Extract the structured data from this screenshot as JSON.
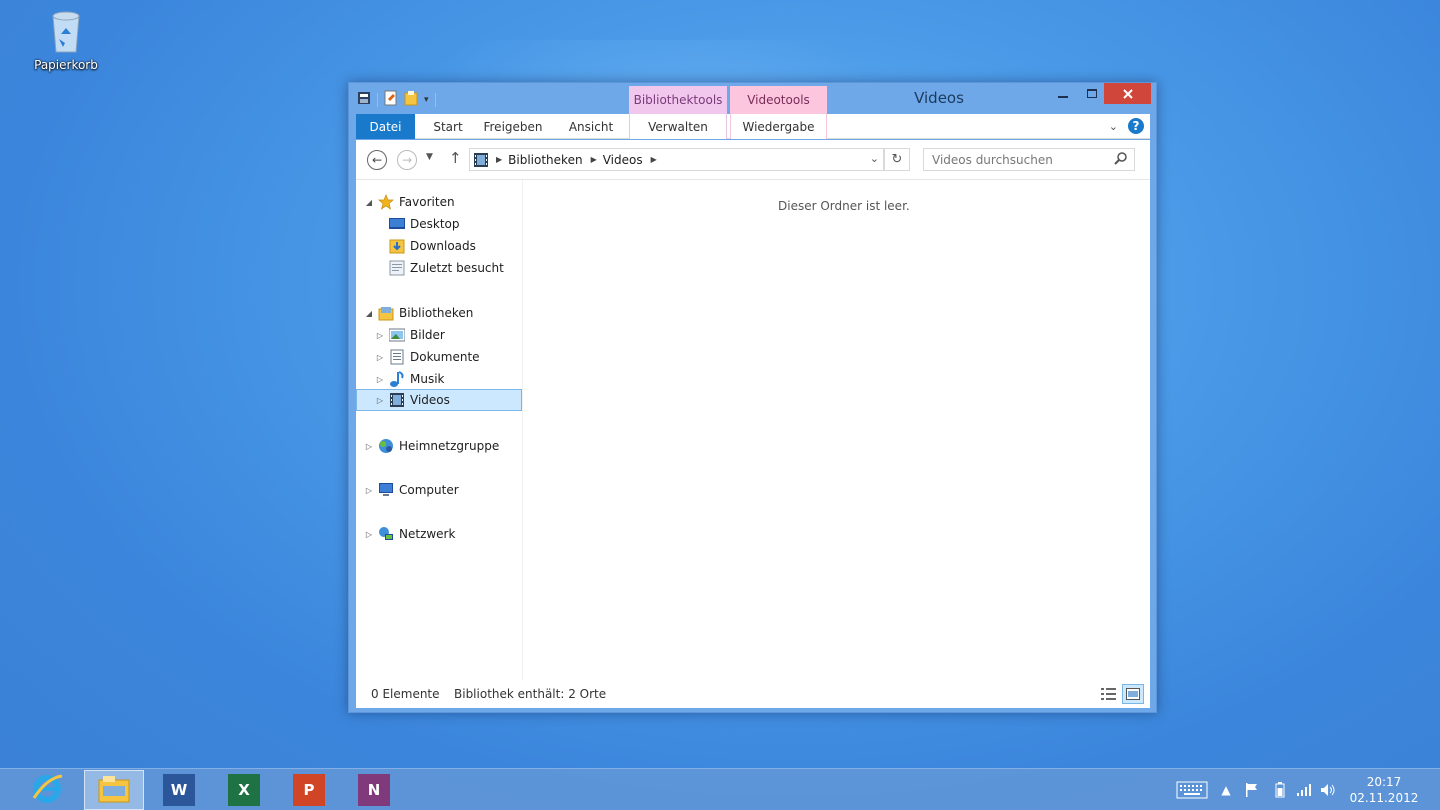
{
  "desktop": {
    "recycle_bin_label": "Papierkorb"
  },
  "window": {
    "title": "Videos",
    "context_tabs": {
      "library_tools": "Bibliothektools",
      "video_tools": "Videotools"
    },
    "ribbon_tabs": {
      "file": "Datei",
      "start": "Start",
      "share": "Freigeben",
      "view": "Ansicht",
      "manage": "Verwalten",
      "playback": "Wiedergabe"
    },
    "address": {
      "parts": [
        "Bibliotheken",
        "Videos"
      ]
    },
    "search": {
      "placeholder": "Videos durchsuchen"
    },
    "tree": {
      "favorites": "Favoriten",
      "desktop": "Desktop",
      "downloads": "Downloads",
      "recent": "Zuletzt besucht",
      "libraries": "Bibliotheken",
      "pictures": "Bilder",
      "documents": "Dokumente",
      "music": "Musik",
      "videos": "Videos",
      "homegroup": "Heimnetzgruppe",
      "computer": "Computer",
      "network": "Netzwerk"
    },
    "empty_message": "Dieser Ordner ist leer.",
    "status": {
      "count": "0 Elemente",
      "library_info": "Bibliothek enthält: 2 Orte"
    }
  },
  "taskbar": {
    "clock_time": "20:17",
    "clock_date": "02.11.2012",
    "apps": [
      "internet-explorer",
      "file-explorer",
      "word",
      "excel",
      "powerpoint",
      "onenote"
    ]
  },
  "colors": {
    "ribbon_file_tab": "#1979ca",
    "close_button": "#d0463a",
    "library_tools": "#f1c7ee",
    "video_tools": "#fcc6de",
    "selection": "#cce8ff"
  }
}
